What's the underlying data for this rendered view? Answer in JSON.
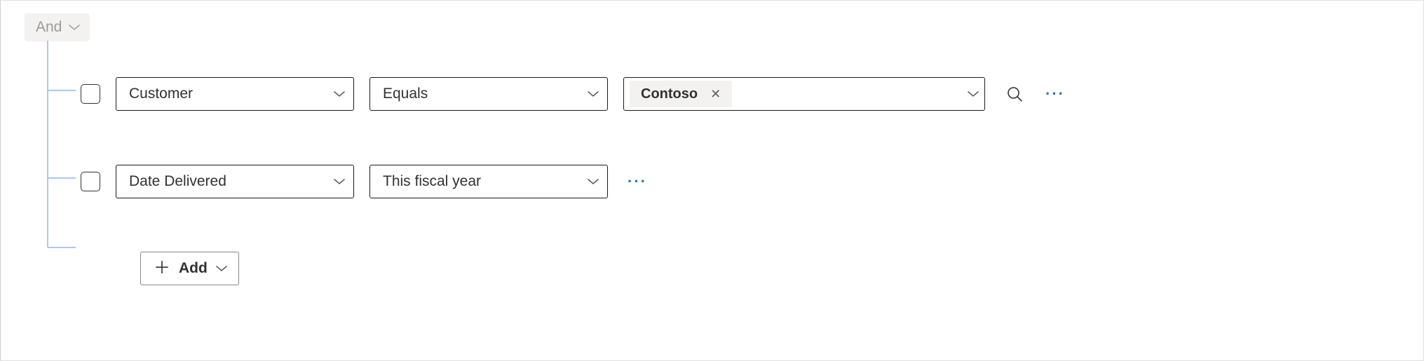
{
  "group": {
    "operator": "And"
  },
  "rows": [
    {
      "field": "Customer",
      "operator": "Equals",
      "value_token": "Contoso"
    },
    {
      "field": "Date Delivered",
      "operator": "This fiscal year"
    }
  ],
  "add_button": {
    "label": "Add"
  },
  "glyphs": {
    "more": "···"
  }
}
